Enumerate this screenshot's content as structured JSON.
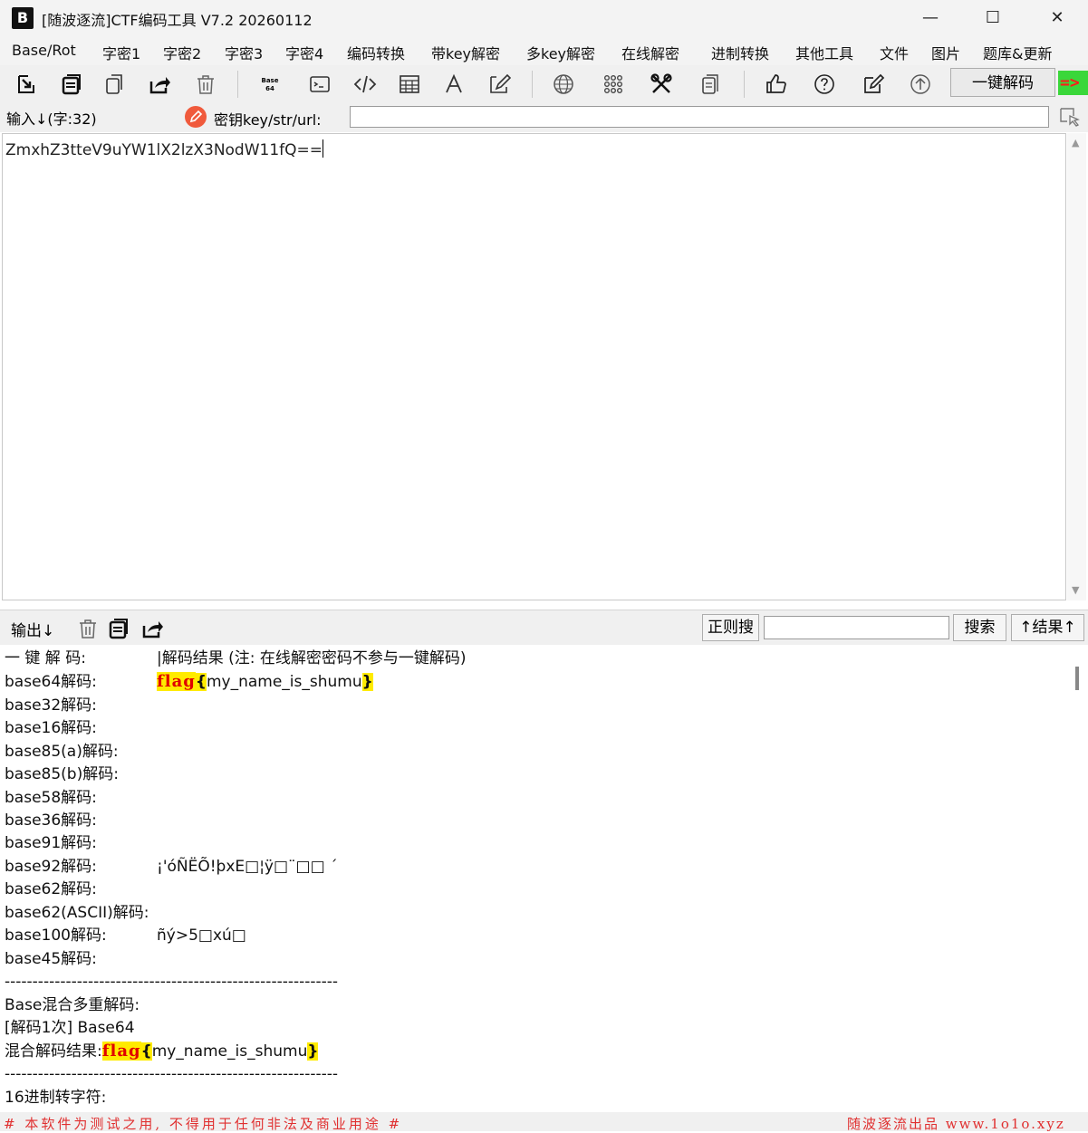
{
  "window": {
    "title": "[随波逐流]CTF编码工具 V7.2  20260112",
    "logo_text": "B",
    "minimize": "—",
    "maximize": "☐",
    "close": "✕"
  },
  "menu": [
    "Base/Rot",
    "字密1",
    "字密2",
    "字密3",
    "字密4",
    "编码转换",
    "带key解密",
    "多key解密",
    "在线解密",
    "进制转换",
    "其他工具",
    "文件",
    "图片",
    "题库&更新"
  ],
  "toolbar": {
    "icons": [
      "import-icon",
      "copy-stack-icon",
      "copy-icon",
      "share-icon",
      "trash-icon",
      "base64-icon",
      "terminal-icon",
      "code-icon",
      "table-icon",
      "font-icon",
      "pen-icon",
      "globe-icon",
      "grid-icon",
      "tools-icon",
      "document-icon",
      "thumbs-up-icon",
      "help-icon",
      "edit-icon",
      "upload-icon"
    ],
    "decode_button": "一键解码",
    "arrow_indicator": "=>"
  },
  "input_row": {
    "label": "输入↓(字:32)",
    "key_label": "密钥key/str/url:",
    "key_value": ""
  },
  "input": {
    "text": "ZmxhZ3tteV9uYW1lX2lzX3NodW11fQ=="
  },
  "output_bar": {
    "label": "输出↓",
    "regex_button": "正则搜",
    "search_value": "",
    "search_button": "搜索",
    "results_button": "↑结果↑"
  },
  "output": {
    "header_label": "一 键 解 码:",
    "header_value": "|解码结果 (注: 在线解密密码不参与一键解码)",
    "base64_label": "base64解码:",
    "flag_keyword": "flag",
    "flag_open": "{",
    "flag_body": "my_name_is_shumu",
    "flag_close": "}",
    "base32_label": "base32解码:",
    "base16_label": "base16解码:",
    "base85a_label": "base85(a)解码:",
    "base85b_label": "base85(b)解码:",
    "base58_label": "base58解码:",
    "base36_label": "base36解码:",
    "base91_label": "base91解码:",
    "base92_label": "base92解码:",
    "base92_value": "¡'óÑËÕ!þxE□¦ÿ□¨□□ ´",
    "base62_label": "base62解码:",
    "base62ascii_label": "base62(ASCII)解码:",
    "base100_label": "base100解码:",
    "base100_value": "ñý>5□xú□",
    "base45_label": "base45解码:",
    "divider": "------------------------------------------------------------",
    "mix_title": "Base混合多重解码:",
    "mix_step": "[解码1次] Base64",
    "mix_result_label": "混合解码结果:",
    "hex_label": "16进制转字符:"
  },
  "footer": {
    "left": "# 本软件为测试之用, 不得用于任何非法及商业用途 #",
    "right": "随波逐流出品 www.1o1o.xyz"
  }
}
